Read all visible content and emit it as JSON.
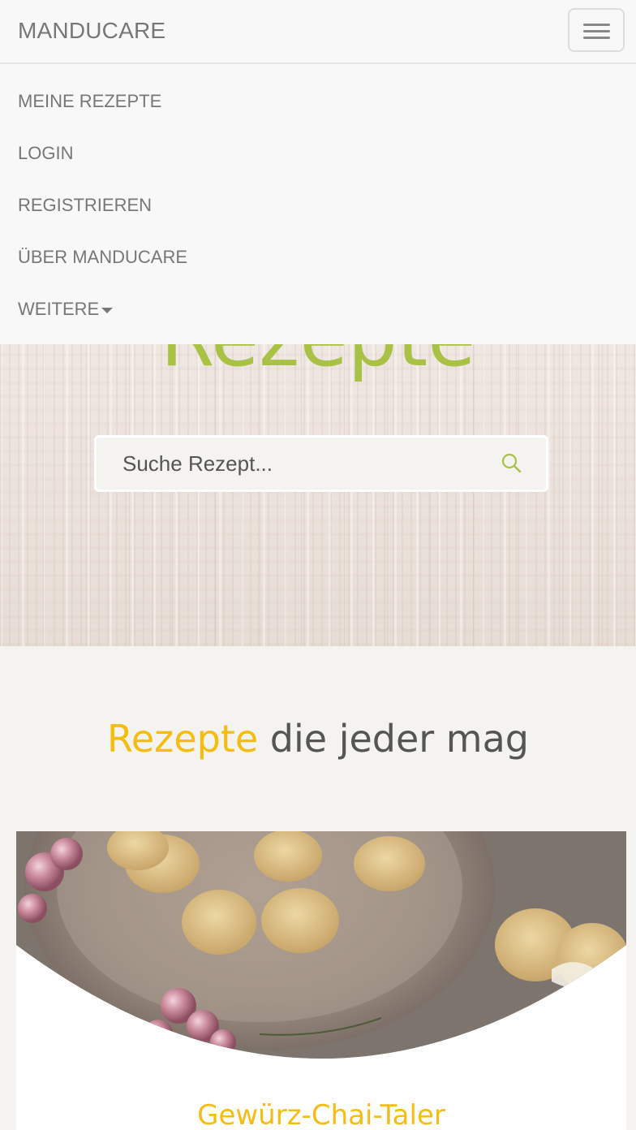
{
  "navbar": {
    "brand": "MANDUCARE",
    "toggle_icon": "hamburger-menu-icon"
  },
  "menu": {
    "items": [
      {
        "label": "MEINE REZEPTE"
      },
      {
        "label": "LOGIN"
      },
      {
        "label": "REGISTRIEREN"
      },
      {
        "label": "ÜBER MANDUCARE"
      },
      {
        "label": "WEITERE",
        "has_caret": true
      }
    ]
  },
  "hero": {
    "title": "Rezepte",
    "search": {
      "placeholder": "Suche Rezept...",
      "icon": "search-icon"
    }
  },
  "section": {
    "heading_accent": "Rezepte",
    "heading_rest": " die jeder mag"
  },
  "recipes": [
    {
      "title": "Gewürz-Chai-Taler"
    }
  ],
  "colors": {
    "accent_green": "#a9c145",
    "accent_yellow": "#f5bd11",
    "nav_text": "#777777",
    "page_bg": "#f4f3f0"
  }
}
